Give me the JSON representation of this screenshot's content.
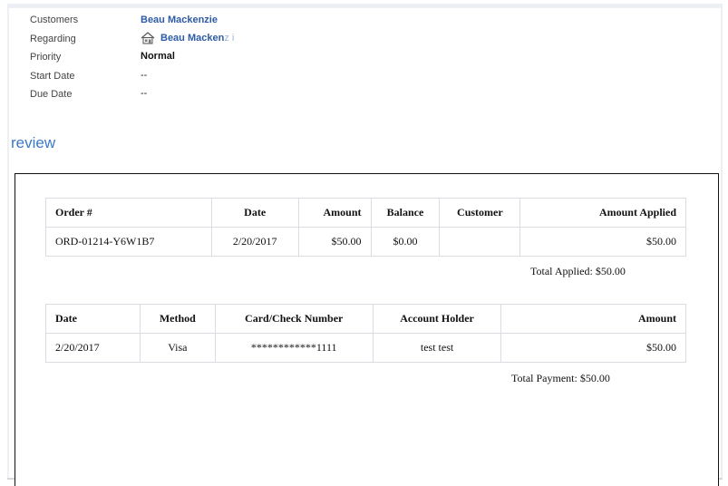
{
  "fields": [
    {
      "label": "Customers",
      "value": "Beau Mackenzie"
    },
    {
      "label": "Regarding",
      "value": "Beau Macken",
      "value_fade": "z i"
    },
    {
      "label": "Priority",
      "value": "Normal"
    },
    {
      "label": "Start Date",
      "value": "--"
    },
    {
      "label": "Due Date",
      "value": "--"
    }
  ],
  "regarding_icon": "house-icon",
  "section": {
    "title": "review"
  },
  "orders": {
    "headers": [
      "Order #",
      "Date",
      "Amount",
      "Balance",
      "Customer",
      "Amount Applied"
    ],
    "rows": [
      [
        "ORD-01214-Y6W1B7",
        "2/20/2017",
        "$50.00",
        "$0.00",
        "",
        "$50.00"
      ]
    ],
    "total": "Total Applied: $50.00"
  },
  "payments": {
    "headers": [
      "Date",
      "Method",
      "Card/Check Number",
      "Account Holder",
      "Amount"
    ],
    "rows": [
      [
        "2/20/2017",
        "Visa",
        "************1111",
        "test test",
        "$50.00"
      ]
    ],
    "total": "Total Payment: $50.00"
  },
  "colors": {
    "link": "#2d5ba6",
    "section_title": "#3c78c8",
    "table_border": "#d9dde2"
  }
}
